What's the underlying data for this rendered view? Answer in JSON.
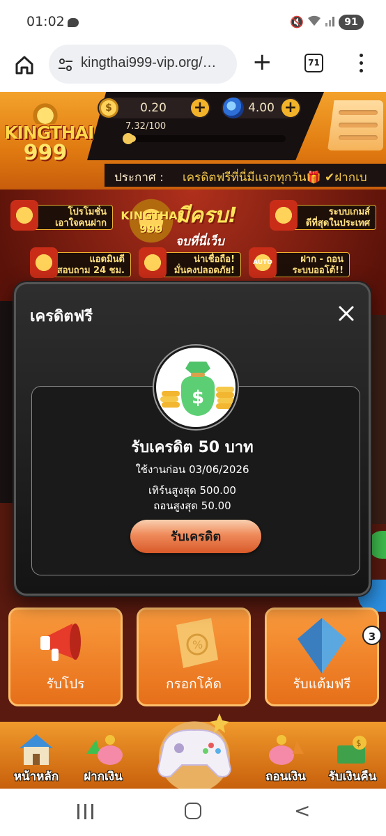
{
  "status_bar": {
    "time": "01:02",
    "battery": "91"
  },
  "browser": {
    "url": "kingthai999-vip.org/…",
    "tab_count": "71"
  },
  "site": {
    "logo_top": "KINGTHAI",
    "logo_bottom": "999",
    "coin_balance": "0.20",
    "gem_balance": "4.00",
    "level_progress": "7.32/100",
    "level_progress_value": 0.0732,
    "announcement_label": "ประกาศ :",
    "announcement_text": "เครดิตฟรีที่นี่มีแจกทุกวัน🎁 ✔ฝากเบ"
  },
  "banner": {
    "chip1": "โปรโมชั่น\nเอาใจคนฝาก",
    "chip2": "ระบบเกมส์\nดีที่สุดในประเทศ",
    "chip3": "แอดมินดี\nสอบถาม 24 ชม.",
    "chip4": "น่าเชื่อถือ!\nมั่นคงปลอดภัย!",
    "chip5": "ฝาก - ถอน\nระบบออโต้!!",
    "auto_badge": "AUTO",
    "logo_text": "KINGTHAI 999",
    "slogan_top": "มีครบ!",
    "slogan_bottom": "จบที่นี่เว็บเดียว!!"
  },
  "tiles": [
    {
      "label": "รับโปร"
    },
    {
      "label": "กรอกโค้ด"
    },
    {
      "label": "รับแต้มฟรี"
    }
  ],
  "floating_badge": "3",
  "bottom_nav": {
    "home": "หน้าหลัก",
    "deposit": "ฝากเงิน",
    "withdraw": "ถอนเงิน",
    "cashback": "รับเงินคืน"
  },
  "modal": {
    "title": "เครดิตฟรี",
    "claim_title": "รับเครดิต 50 บาท",
    "use_before": "ใช้งานก่อน 03/06/2026",
    "turnover": "เทิร์นสูงสุด 500.00",
    "withdraw_max": "ถอนสูงสุด 50.00",
    "claim_button": "รับเครดิต"
  },
  "colors": {
    "accent_orange": "#e07a10",
    "modal_bg": "#1a1a1a",
    "claim_button": "#ef8a5a",
    "announcement_text": "#f2c84a"
  }
}
